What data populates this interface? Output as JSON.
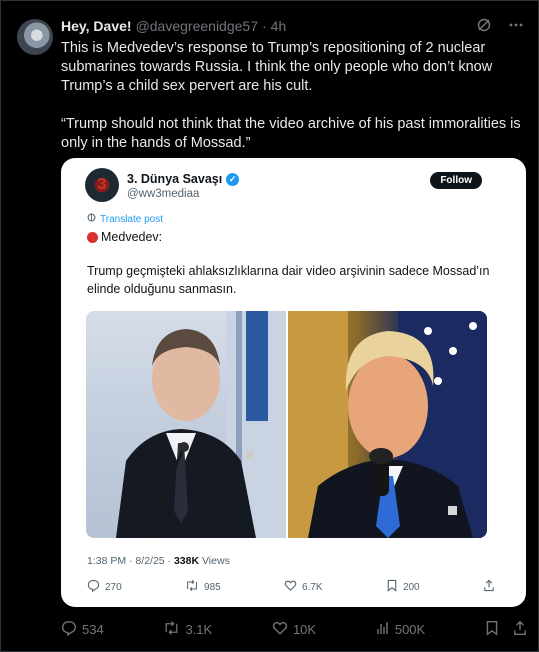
{
  "post": {
    "display_name": "Hey, Dave!",
    "handle": "@davegreenidge57",
    "separator": "·",
    "age": "4h",
    "text_line1": "This is Medvedev’s response to Trump’s repositioning of 2 nuclear submarines towards Russia. I think the only people who don’t know Trump’s a child sex pervert are his cult.",
    "text_line2": "“Trump should not think that the video archive of his past immoralities is only in the hands of Mossad.”",
    "actions": {
      "replies": "534",
      "reposts": "3.1K",
      "likes": "10K",
      "views": "500K"
    }
  },
  "quoted": {
    "display_name": "3. Dünya Savaşı",
    "handle": "@ww3mediaa",
    "avatar_glyph": "3",
    "follow_label": "Follow",
    "translate_label": "Translate post",
    "headline": "Medvedev:",
    "body": "Trump geçmişteki ahlaksızlıklarına dair video arşivinin sadece Mossad’ın elinde olduğunu sanmasın.",
    "time": "1:38 PM · 8/2/25 · ",
    "views_count": "338K",
    "views_label": " Views",
    "actions": {
      "replies": "270",
      "reposts": "985",
      "likes": "6.7K",
      "bookmarks": "200"
    }
  },
  "icons": [
    "grok-icon",
    "more-icon",
    "reply-icon",
    "repost-icon",
    "like-icon",
    "views-icon",
    "bookmark-icon",
    "share-icon",
    "verified-icon",
    "translate-icon"
  ],
  "colors": {
    "accent": "#1d9bf0",
    "background": "#000000",
    "card": "#ffffff",
    "muted": "#71767b"
  }
}
